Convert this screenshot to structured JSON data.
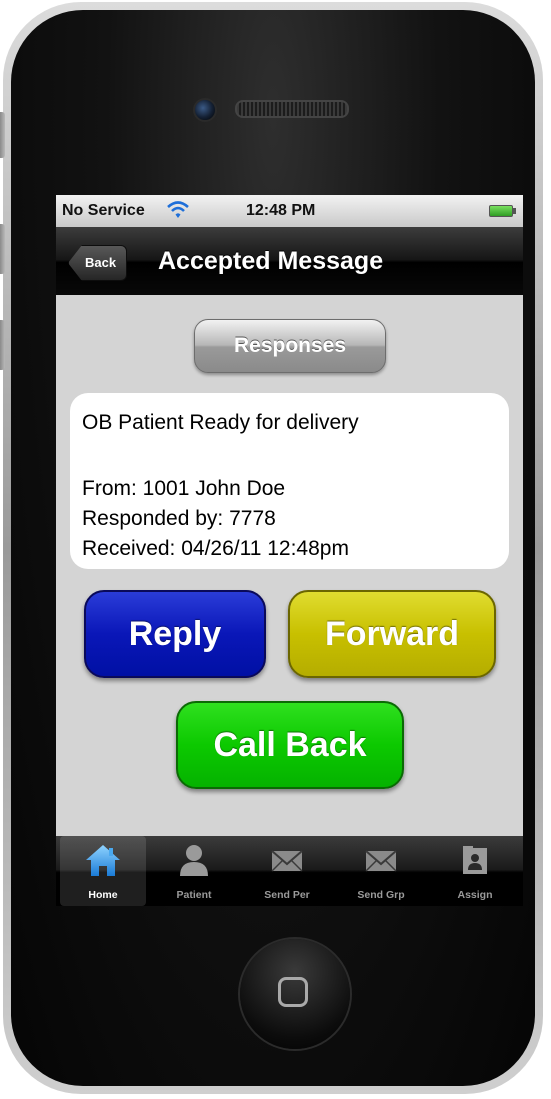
{
  "status_bar": {
    "carrier": "No Service",
    "time": "12:48 PM"
  },
  "nav": {
    "back_label": "Back",
    "title": "Accepted Message"
  },
  "responses_label": "Responses",
  "message": {
    "subject": "OB Patient Ready for delivery",
    "from": "From: 1001 John Doe",
    "responded_by": "Responded by: 7778",
    "received": "Received: 04/26/11 12:48pm"
  },
  "actions": {
    "reply": "Reply",
    "forward": "Forward",
    "call_back": "Call Back"
  },
  "tabs": [
    {
      "label": "Home",
      "icon": "home-icon",
      "active": true
    },
    {
      "label": "Patient",
      "icon": "person-icon",
      "active": false
    },
    {
      "label": "Send Per",
      "icon": "envelope-icon",
      "active": false
    },
    {
      "label": "Send Grp",
      "icon": "envelope-icon",
      "active": false
    },
    {
      "label": "Assign",
      "icon": "assign-icon",
      "active": false
    }
  ],
  "colors": {
    "reply": "#0010a4",
    "forward": "#c8c000",
    "call_back": "#0cc900",
    "screen_bg": "#d4d4d4"
  }
}
